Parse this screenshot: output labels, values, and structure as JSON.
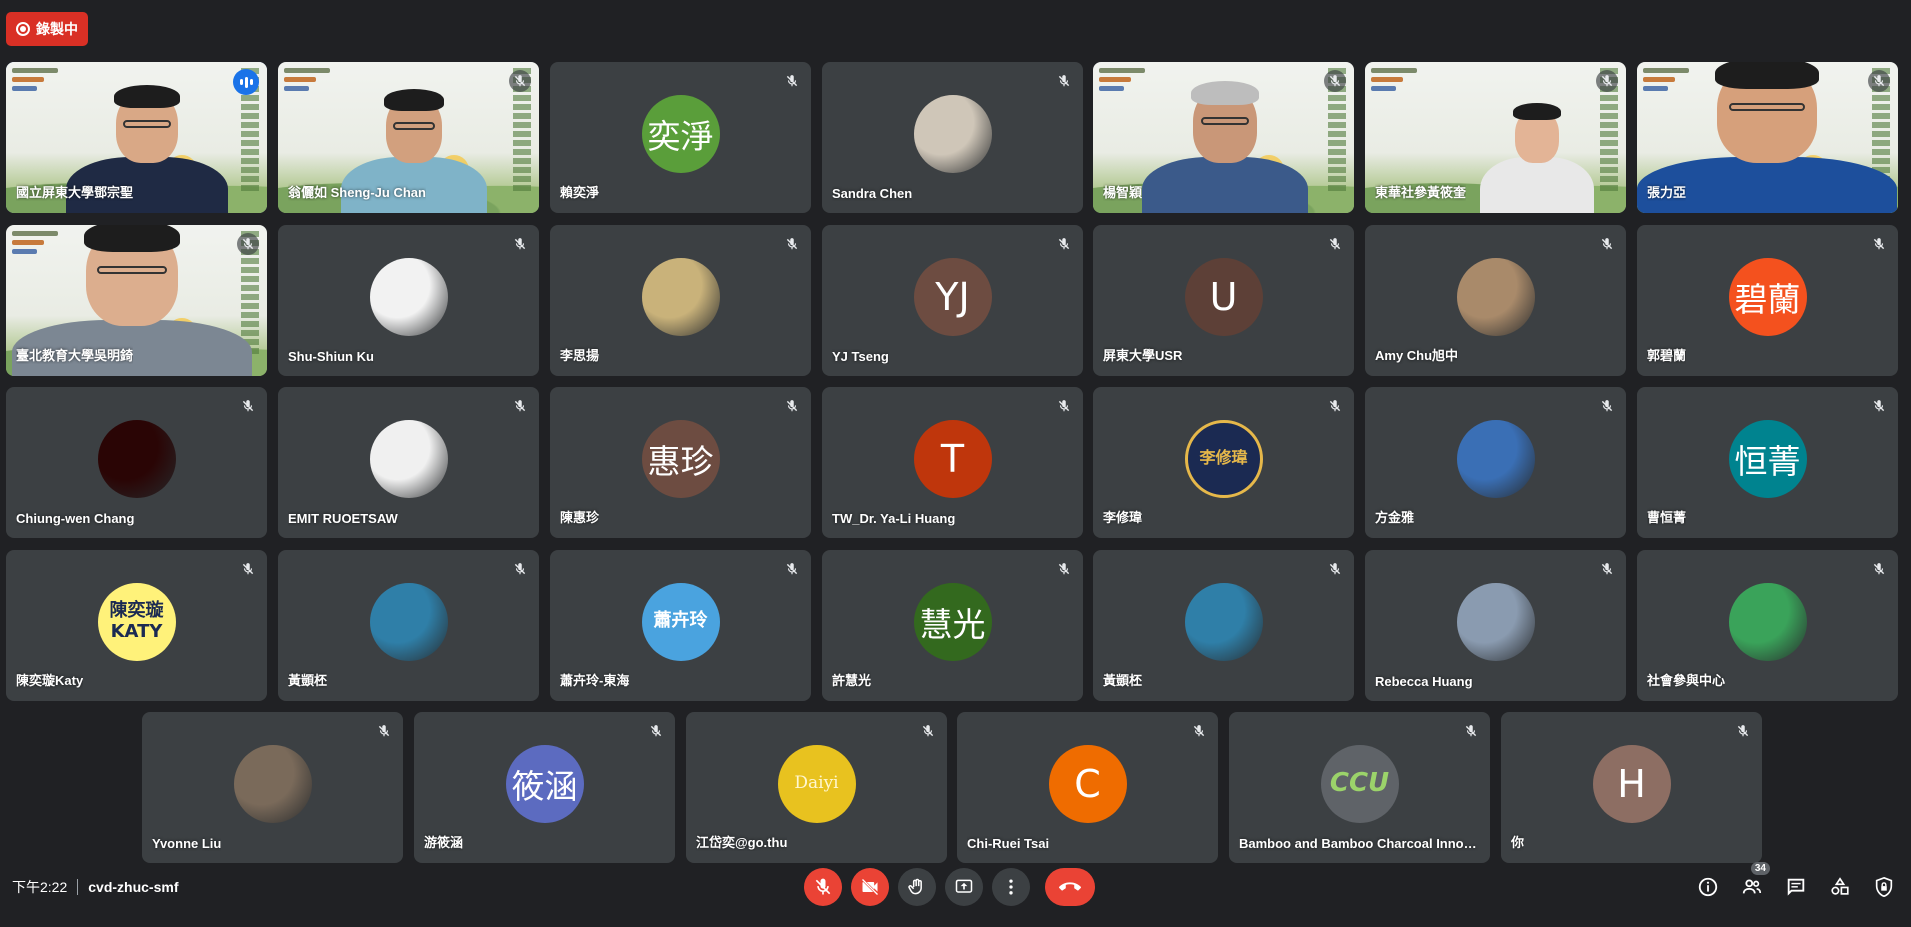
{
  "recording": {
    "label": "錄製中",
    "color": "#d93025"
  },
  "meeting": {
    "time": "下午2:22",
    "code": "cvd-zhuc-smf",
    "participant_count": "34"
  },
  "participants": [
    {
      "name": "國立屏東大學鄧宗聖",
      "kind": "video",
      "speaking": true
    },
    {
      "name": "翁儷如 Sheng-Ju Chan",
      "kind": "video"
    },
    {
      "name": "賴奕淨",
      "kind": "initials",
      "avatar_text": "奕淨",
      "avatar_color": "#5a9e3a"
    },
    {
      "name": "Sandra Chen",
      "kind": "photo",
      "avatar_color": "#cfc6b8"
    },
    {
      "name": "楊智穎",
      "kind": "video"
    },
    {
      "name": "東華社參黃筱奎",
      "kind": "video"
    },
    {
      "name": "張力亞",
      "kind": "video"
    },
    {
      "name": "臺北教育大學吳明錡",
      "kind": "video"
    },
    {
      "name": "Shu-Shiun Ku",
      "kind": "photo",
      "avatar_color": "#f2f2f2"
    },
    {
      "name": "李思揚",
      "kind": "photo",
      "avatar_color": "#c9b27a"
    },
    {
      "name": "YJ Tseng",
      "kind": "initials",
      "avatar_text": "YJ",
      "avatar_color": "#6d4c41"
    },
    {
      "name": "屏東大學USR",
      "kind": "initials",
      "avatar_text": "U",
      "avatar_color": "#5d4037"
    },
    {
      "name": "Amy Chu旭中",
      "kind": "photo",
      "avatar_color": "#a98a6a"
    },
    {
      "name": "郭碧蘭",
      "kind": "initials",
      "avatar_text": "碧蘭",
      "avatar_color": "#f4511e"
    },
    {
      "name": "Chiung-wen Chang",
      "kind": "photo",
      "avatar_color": "#2a0505"
    },
    {
      "name": "EMIT RUOETSAW",
      "kind": "photo",
      "avatar_color": "#f0f0f0"
    },
    {
      "name": "陳惠珍",
      "kind": "initials",
      "avatar_text": "惠珍",
      "avatar_color": "#6d4c41"
    },
    {
      "name": "TW_Dr. Ya-Li Huang",
      "kind": "initials",
      "avatar_text": "T",
      "avatar_color": "#bf360c"
    },
    {
      "name": "李修瑋",
      "kind": "logo",
      "avatar_text": "李修瑋",
      "avatar_color": "#1b2a52"
    },
    {
      "name": "方金雅",
      "kind": "photo",
      "avatar_color": "#3a6fb5"
    },
    {
      "name": "曹恒菁",
      "kind": "initials",
      "avatar_text": "恒菁",
      "avatar_color": "#00838f"
    },
    {
      "name": "陳奕璇Katy",
      "kind": "logo",
      "avatar_text": "陳奕璇\nKATY",
      "avatar_color": "#fff27a"
    },
    {
      "name": "黃顗柸",
      "kind": "photo",
      "avatar_color": "#2f7fa8"
    },
    {
      "name": "蕭卉玲-東海",
      "kind": "logo",
      "avatar_text": "蕭卉玲",
      "avatar_color": "#4aa3df"
    },
    {
      "name": "許慧光",
      "kind": "initials",
      "avatar_text": "慧光",
      "avatar_color": "#33691e"
    },
    {
      "name": "黃顗柸",
      "kind": "photo",
      "avatar_color": "#2f7fa8"
    },
    {
      "name": "Rebecca Huang",
      "kind": "photo",
      "avatar_color": "#8a9bb0"
    },
    {
      "name": "社會參與中心",
      "kind": "photo",
      "avatar_color": "#3aa35a"
    },
    {
      "name": "Yvonne Liu",
      "kind": "photo",
      "avatar_color": "#7a6a5a"
    },
    {
      "name": "游筱涵",
      "kind": "initials",
      "avatar_text": "筱涵",
      "avatar_color": "#5c6bc0"
    },
    {
      "name": "江岱奕@go.thu",
      "kind": "logo",
      "avatar_text": "Daiyi",
      "avatar_color": "#e8c21f"
    },
    {
      "name": "Chi-Ruei Tsai",
      "kind": "initials",
      "avatar_text": "C",
      "avatar_color": "#ef6c00"
    },
    {
      "name": "Bamboo and Bamboo Charcoal Innova...",
      "kind": "logo",
      "avatar_text": "CCU",
      "avatar_color": "#5f6368"
    },
    {
      "name": "你",
      "kind": "initials",
      "avatar_text": "H",
      "avatar_color": "#8d6e63"
    }
  ]
}
